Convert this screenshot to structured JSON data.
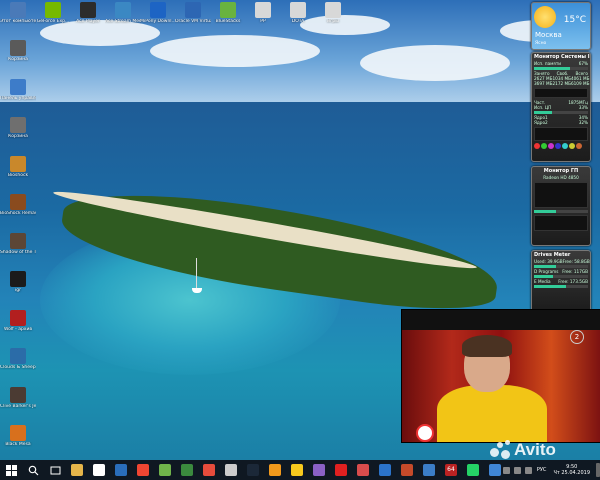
{
  "desktop_icons": [
    {
      "name": "computer",
      "label": "Этот компьютер",
      "color": "#4a7ab8"
    },
    {
      "name": "geforce",
      "label": "GeForce Exp...",
      "color": "#76b900"
    },
    {
      "name": "aceplayer",
      "label": "Ace Player",
      "color": "#2c2c2c"
    },
    {
      "name": "acestream",
      "label": "Ace Stream Media Center",
      "color": "#3b88c3"
    },
    {
      "name": "mipony",
      "label": "MiPony Downl...",
      "color": "#1d64c4"
    },
    {
      "name": "virtualbox",
      "label": "Oracle VM VirtualBox",
      "color": "#2d66b3"
    },
    {
      "name": "bluestacks",
      "label": "BlueStacks",
      "color": "#69b33f"
    },
    {
      "name": "folder-pp",
      "label": "PP",
      "color": "#d8d8d8"
    },
    {
      "name": "folder-dota",
      "label": "DOTA",
      "color": "#d8d8d8"
    },
    {
      "name": "folder-igry",
      "label": "игры",
      "color": "#d8d8d8"
    },
    {
      "name": "recycle",
      "label": "Корзина",
      "color": "#5a5a5a"
    },
    {
      "name": "control-panel",
      "label": "Панель управления",
      "color": "#3d7cc9"
    },
    {
      "name": "trash",
      "label": "Корзина",
      "color": "#6f6f6f"
    },
    {
      "name": "bioshock",
      "label": "Bioshock",
      "color": "#c9882b"
    },
    {
      "name": "bioshock-remastered",
      "label": "BioShock Remastered",
      "color": "#8a4b1e"
    },
    {
      "name": "shadow",
      "label": "Shadow of the Tomb Raider",
      "color": "#5c4636"
    },
    {
      "name": "ghost",
      "label": "igr",
      "color": "#1b1b1b"
    },
    {
      "name": "wolfenstein",
      "label": "Wolf - архив",
      "color": "#b21f1f"
    },
    {
      "name": "clouds",
      "label": "Clouds & Sheep 2",
      "color": "#2b6ca8"
    },
    {
      "name": "clive",
      "label": "Clive Barker's Jericho",
      "color": "#4b3b33"
    },
    {
      "name": "blackmesa",
      "label": "Black Mesa",
      "color": "#d8701d"
    }
  ],
  "weather": {
    "temp": "15°C",
    "city": "Москва",
    "condition": "Ясно"
  },
  "system_monitor": {
    "title": "Монитор Системы II",
    "memory_label": "Исп. памяти",
    "memory_value": "67%",
    "cols": [
      "Занято",
      "Своб.",
      "Всего"
    ],
    "row1": [
      "2627 МБ",
      "1034 МБ",
      "4061 МБ"
    ],
    "row2": [
      "3697 МБ",
      "2172 МБ",
      "6109 МБ"
    ],
    "cpu_label": "Исп. ЦП",
    "cpu_value": "33%",
    "freq_label": "Част.",
    "freq_value": "1875МГц",
    "core1": "Ядро1",
    "core1_value": "34%",
    "core2": "Ядро2",
    "core2_value": "32%",
    "mem_pct": 67,
    "cpu_pct": 33
  },
  "gpu_monitor": {
    "title": "Монитор ГП",
    "gpu_name": "Radeon HD 4850",
    "gpu_pct": 40
  },
  "drives_meter": {
    "title": "Drives Meter",
    "drives": [
      {
        "label": "Used: 39.9GB",
        "free": "Free: 58.8GB",
        "pct": 40
      },
      {
        "label": "D Programs",
        "free": "Free: 117GB",
        "pct": 35
      },
      {
        "label": "E Media",
        "free": "Free: 173.5GB",
        "pct": 60
      }
    ]
  },
  "taskbar": {
    "apps": [
      {
        "name": "file-explorer",
        "color": "#e6b54a"
      },
      {
        "name": "yandex-browser",
        "color": "#ffffff"
      },
      {
        "name": "store",
        "color": "#2a6ebb"
      },
      {
        "name": "yandex",
        "color": "#f04632"
      },
      {
        "name": "utorrent",
        "color": "#70b44b"
      },
      {
        "name": "chrome",
        "color": "#3b8a3e"
      },
      {
        "name": "media",
        "color": "#e74c3c"
      },
      {
        "name": "camera",
        "color": "#cccccc"
      },
      {
        "name": "steam",
        "color": "#1b2838"
      },
      {
        "name": "vlc",
        "color": "#f29a1c"
      },
      {
        "name": "aimp",
        "color": "#f7c91e"
      },
      {
        "name": "visual-studio",
        "color": "#8b61c6"
      },
      {
        "name": "acrobat",
        "color": "#e02020"
      },
      {
        "name": "paint",
        "color": "#d94c4c"
      },
      {
        "name": "internet-explorer",
        "color": "#2b73c9"
      },
      {
        "name": "sysmon",
        "color": "#c54a2a"
      },
      {
        "name": "save",
        "color": "#3b7ec8"
      },
      {
        "name": "counter",
        "color": "#bb2222"
      },
      {
        "name": "whatsapp",
        "color": "#25d366"
      },
      {
        "name": "user",
        "color": "#3f86d6"
      }
    ],
    "counter_label": "64",
    "language": "РУС",
    "time": "9:50",
    "date": "Чт 25.04.2019"
  },
  "video": {
    "channel_mark": "2"
  },
  "watermark": "Avito"
}
